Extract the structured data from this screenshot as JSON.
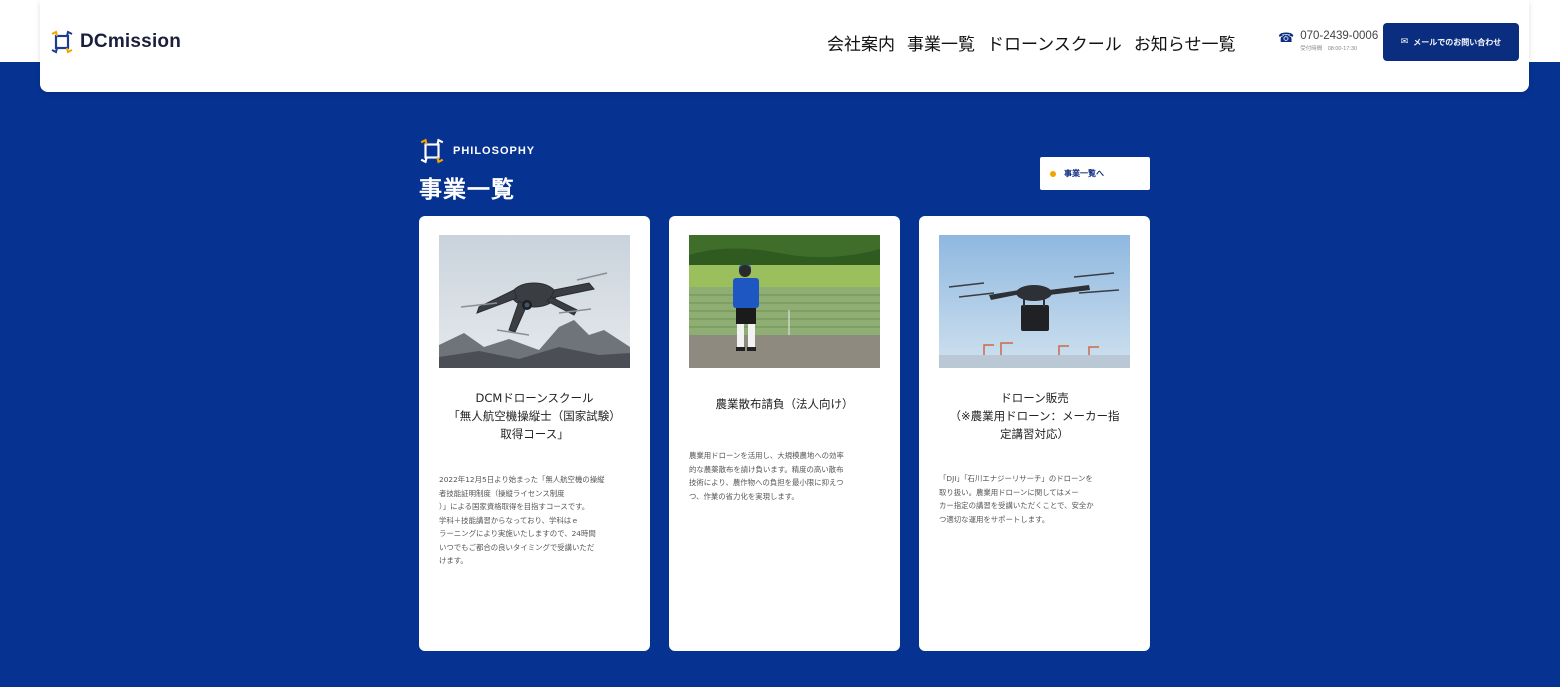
{
  "header": {
    "logo_text": "DCmission",
    "nav": [
      "会社案内",
      "事業一覧",
      "ドローンスクール",
      "お知らせ一覧"
    ],
    "phone": "070-2439-0006",
    "phone_hours": "受付時間　08:00-17:30",
    "mail_button": "メールでのお問い合わせ"
  },
  "section": {
    "eyebrow": "PHILOSOPHY",
    "title": "事業一覧",
    "more_button": "事業一覧へ"
  },
  "cards": [
    {
      "title_lines": [
        "DCMドローンスクール",
        "「無人航空機操縦士（国家試験）",
        "取得コース」"
      ],
      "desc_lines": [
        "2022年12月5日より始まった「無人航空機の操縦",
        "者技能証明制度（操縦ライセンス制度",
        "）」による国家資格取得を目指すコースです。",
        "学科＋技能講習からなっており、学科はｅ",
        "ラーニングにより実施いたしますので、24時間",
        "いつでもご都合の良いタイミングで受講いただ",
        "けます。"
      ]
    },
    {
      "title_lines": [
        "農業散布請負（法人向け）"
      ],
      "desc_lines": [
        "農業用ドローンを活用し、大規模農地への効率",
        "的な農薬散布を請け負います。精度の高い散布",
        "技術により、農作物への負担を最小限に抑えつ",
        "つ、作業の省力化を実現します。"
      ]
    },
    {
      "title_lines": [
        "ドローン販売",
        "（※農業用ドローン：メーカー指",
        "定講習対応）"
      ],
      "desc_lines": [
        "「DJI」「石川エナジーリサーチ」のドローンを",
        "取り扱い。農業用ドローンに関してはメー",
        "カー指定の講習を受講いただくことで、安全か",
        "つ適切な運用をサポートします。"
      ]
    }
  ],
  "colors": {
    "brand_blue": "#063391",
    "button_blue": "#0a2d80",
    "accent_orange": "#f2a500"
  },
  "icons": [
    "dcmission-logo-icon",
    "phone-icon",
    "mail-icon",
    "philosophy-logo-icon"
  ]
}
